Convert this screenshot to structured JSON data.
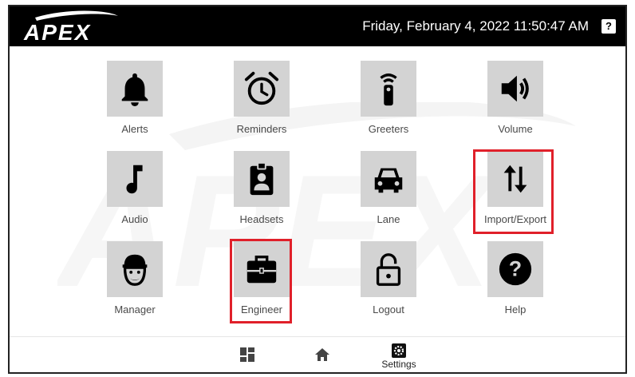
{
  "header": {
    "logo_text": "APEX",
    "datetime": "Friday, February 4, 2022 11:50:47 AM",
    "help_glyph": "?"
  },
  "tiles": [
    {
      "label": "Alerts",
      "icon": "bell-icon"
    },
    {
      "label": "Reminders",
      "icon": "alarm-clock-icon"
    },
    {
      "label": "Greeters",
      "icon": "remote-icon"
    },
    {
      "label": "Volume",
      "icon": "speaker-icon"
    },
    {
      "label": "Audio",
      "icon": "music-note-icon"
    },
    {
      "label": "Headsets",
      "icon": "badge-icon"
    },
    {
      "label": "Lane",
      "icon": "car-icon"
    },
    {
      "label": "Import/Export",
      "icon": "import-export-icon"
    },
    {
      "label": "Manager",
      "icon": "manager-icon"
    },
    {
      "label": "Engineer",
      "icon": "toolbox-icon"
    },
    {
      "label": "Logout",
      "icon": "unlock-icon"
    },
    {
      "label": "Help",
      "icon": "help-circle-icon"
    }
  ],
  "bottom_nav": [
    {
      "label": "",
      "icon": "dashboard-icon"
    },
    {
      "label": "",
      "icon": "home-icon"
    },
    {
      "label": "Settings",
      "icon": "settings-gear-icon"
    }
  ],
  "colors": {
    "topbar": "#000000",
    "tile_bg": "#d3d3d3",
    "highlight": "#e0202a"
  }
}
